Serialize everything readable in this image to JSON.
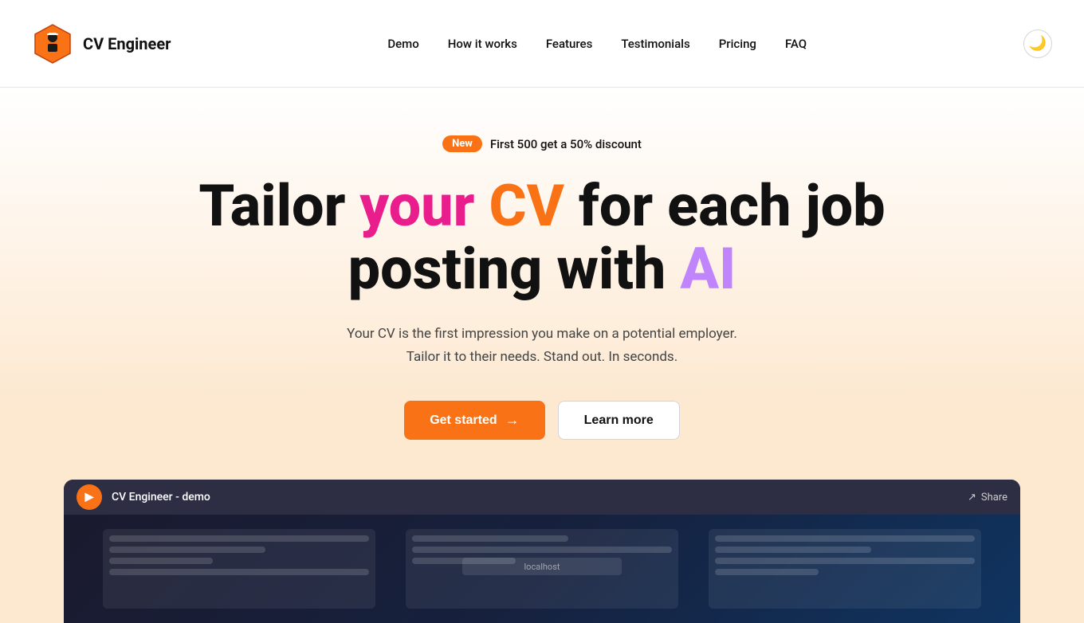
{
  "nav": {
    "logo_text": "CV Engineer",
    "links": [
      {
        "label": "Demo",
        "id": "demo"
      },
      {
        "label": "How it works",
        "id": "how-it-works"
      },
      {
        "label": "Features",
        "id": "features"
      },
      {
        "label": "Testimonials",
        "id": "testimonials"
      },
      {
        "label": "Pricing",
        "id": "pricing"
      },
      {
        "label": "FAQ",
        "id": "faq"
      }
    ],
    "dark_toggle_icon": "🌙"
  },
  "hero": {
    "badge_new": "New",
    "badge_text": "First 500 get a 50% discount",
    "headline_part1": "Tailor ",
    "headline_your": "your",
    "headline_space1": " ",
    "headline_cv": "CV",
    "headline_part2": " for each job posting with ",
    "headline_ai": "AI",
    "subline1": "Your CV is the first impression you make on a potential employer.",
    "subline2": "Tailor it to their needs. Stand out. In seconds.",
    "cta_primary": "Get started",
    "cta_secondary": "Learn more"
  },
  "video": {
    "title": "CV Engineer - demo",
    "share_label": "Share",
    "url_bar": "localhost"
  },
  "colors": {
    "orange": "#f97316",
    "pink": "#e91e8c",
    "purple": "#c084fc",
    "bg_gradient_end": "#fde8d0"
  }
}
